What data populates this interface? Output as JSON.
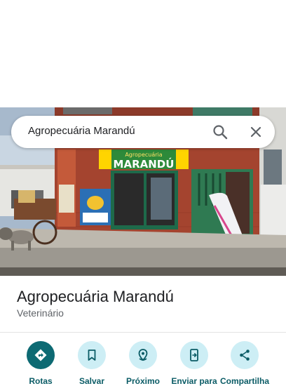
{
  "search": {
    "query": "Agropecuária Marandú"
  },
  "photo": {
    "sign_top": "Agropecuária",
    "sign_main": "MARANDÚ"
  },
  "place": {
    "name": "Agropecuária Marandú",
    "category": "Veterinário"
  },
  "actions": [
    {
      "label": "Rotas",
      "icon": "directions-icon"
    },
    {
      "label": "Salvar",
      "icon": "bookmark-icon"
    },
    {
      "label": "Próximo",
      "icon": "nearby-icon"
    },
    {
      "label": "Enviar para",
      "icon": "send-to-device-icon"
    },
    {
      "label": "Compartilha",
      "icon": "share-icon"
    }
  ],
  "colors": {
    "accent": "#0d6a73",
    "action_bg": "#cdeef5",
    "label": "#0b5c66"
  }
}
